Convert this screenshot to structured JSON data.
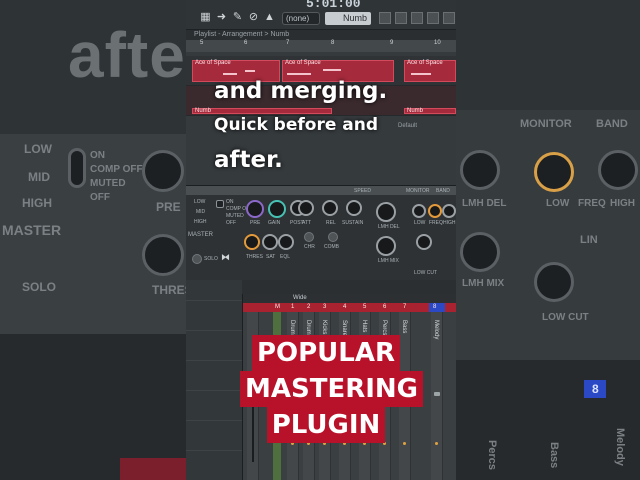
{
  "backdrop": {
    "left_word": "after",
    "left_labels": [
      "LOW",
      "MID",
      "HIGH",
      "ON",
      "COMP OFF",
      "MUTED",
      "OFF",
      "PRE",
      "MASTER",
      "SOLO",
      "THRES"
    ],
    "right_labels": [
      "MONITOR",
      "BAND",
      "LMH DEL",
      "LOW",
      "FREQ",
      "HIGH",
      "LIN",
      "LMH MIX",
      "LOW CUT",
      "Percs",
      "Bass",
      "Melody",
      "8"
    ]
  },
  "toolbar": {
    "time": "5:01:00",
    "pattern": "(none)",
    "snap": "Numb"
  },
  "playlist": {
    "title": "Playlist - Arrangement > Numb",
    "ruler": [
      "5",
      "6",
      "7",
      "8",
      "9",
      "10"
    ],
    "tracks": [
      {
        "clips": [
          "Ace of Space",
          "Ace of Space",
          "Ace of Space"
        ]
      },
      {
        "clips": [
          "Numb",
          "Numb"
        ]
      }
    ],
    "zoom_label": "Default"
  },
  "mixer_top": {
    "labels": [
      "LOW",
      "MID",
      "HIGH",
      "ON",
      "COMP OFF",
      "MUTED",
      "OFF",
      "PRE",
      "GAIN",
      "POST",
      "ATT",
      "REL",
      "SUSTAIN",
      "CHR",
      "COMB",
      "THRES",
      "SAT",
      "EQL",
      "MASTER",
      "SOLO",
      "LMH DEL",
      "LMH MIX",
      "LOW",
      "FREQ",
      "HIGH",
      "LOW CUT",
      "MONITOR",
      "BAND",
      "SPEED"
    ]
  },
  "mixer": {
    "title": "Wide",
    "channels": [
      "M",
      "1",
      "2",
      "3",
      "4",
      "5",
      "6",
      "7",
      "8"
    ],
    "strip_names": [
      "Drum and",
      "Drum and",
      "Kicks",
      "Snares",
      "Hats",
      "Percs",
      "Bass",
      "Melody"
    ]
  },
  "captions": {
    "line1": "and merging.",
    "line2": "Quick before and",
    "line3": "after."
  },
  "title": {
    "lines": [
      "POPULAR",
      "MASTERING",
      "PLUGIN"
    ]
  },
  "colors": {
    "accent_red": "#b7122a",
    "clip_red": "#a52a3b",
    "select_blue": "#2c49c5"
  }
}
